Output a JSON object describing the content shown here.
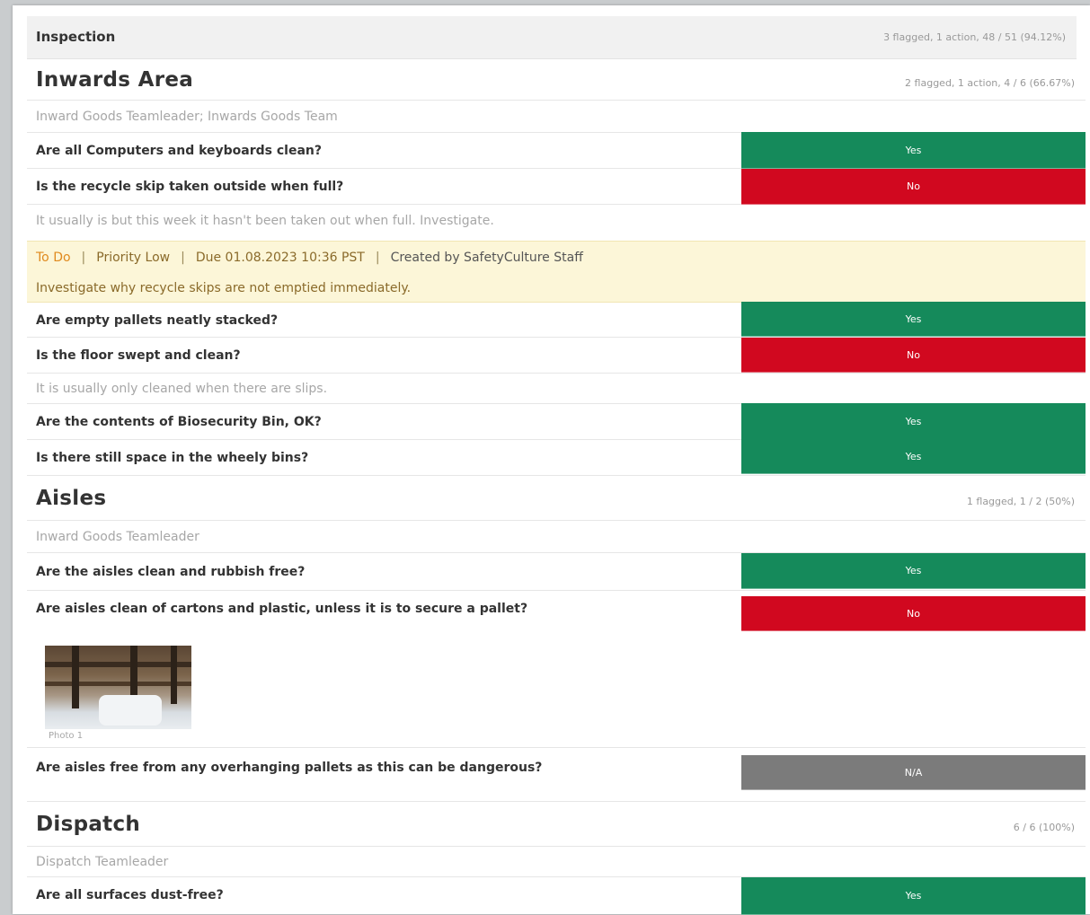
{
  "inspection": {
    "title": "Inspection",
    "stats": "3 flagged, 1 action, 48 / 51 (94.12%)"
  },
  "sections": [
    {
      "title": "Inwards Area",
      "stats": "2 flagged, 1 action, 4 / 6 (66.67%)",
      "assignee": "Inward Goods Teamleader; Inwards Goods Team",
      "questions": [
        {
          "text": "Are all Computers and keyboards clean?",
          "answer": "Yes"
        },
        {
          "text": "Is the recycle skip taken outside when full?",
          "answer": "No",
          "note": "It usually is but this week it hasn't been taken out when full. Investigate."
        },
        {
          "text": "Are empty pallets neatly stacked?",
          "answer": "Yes"
        },
        {
          "text": "Is the floor swept and clean?",
          "answer": "No",
          "note": "It is usually only cleaned when there are slips."
        },
        {
          "text": "Are the contents of Biosecurity Bin, OK?",
          "answer": "Yes"
        },
        {
          "text": "Is there still space in the wheely bins?",
          "answer": "Yes"
        }
      ]
    },
    {
      "title": "Aisles",
      "stats": "1 flagged, 1 / 2 (50%)",
      "assignee": "Inward Goods Teamleader",
      "questions": [
        {
          "text": "Are the aisles clean and rubbish free?",
          "answer": "Yes"
        },
        {
          "text": "Are aisles clean of cartons and plastic, unless it is to secure a pallet?",
          "answer": "No",
          "photo_caption": "Photo 1"
        },
        {
          "text": "Are aisles free from any overhanging pallets as this can be dangerous?",
          "answer": "N/A"
        }
      ]
    },
    {
      "title": "Dispatch",
      "stats": "6 / 6 (100%)",
      "assignee": "Dispatch Teamleader",
      "questions": [
        {
          "text": "Are all surfaces dust-free?",
          "answer": "Yes"
        }
      ]
    }
  ],
  "action": {
    "status": "To Do",
    "priority": "Priority Low",
    "due": "Due 01.08.2023 10:36 PST",
    "creator": "Created by SafetyCulture Staff",
    "description": "Investigate why recycle skips are not emptied immediately."
  },
  "colors": {
    "yes": "#158a5b",
    "no": "#d1081f",
    "na": "#7b7b7b",
    "action_bg": "#fcf6d8"
  }
}
